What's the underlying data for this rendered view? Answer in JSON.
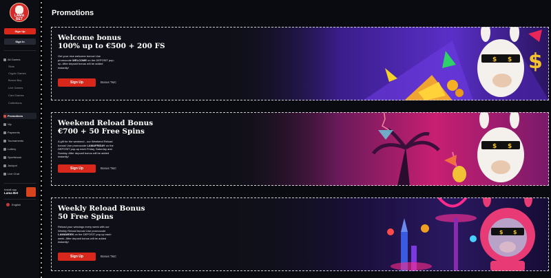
{
  "brand": {
    "logo_text": "LAMA BET"
  },
  "sidebar": {
    "signup_label": "Sign Up",
    "signin_label": "Sign In",
    "games_label": "All Games",
    "sub_items": [
      "Slots",
      "Crypto Games",
      "Bonus Buy",
      "Live Games",
      "Card Games",
      "Collections"
    ],
    "items": [
      "Promotions",
      "Vip",
      "Payments",
      "Tournaments",
      "Lottery",
      "Sportsbook",
      "Jackpot",
      "Live Chat"
    ],
    "install_line1": "Install app",
    "install_line2": "Lama Bet",
    "language": "English"
  },
  "page": {
    "title": "Promotions"
  },
  "promos": [
    {
      "title_line1": "Welcome bonus",
      "title_line2": "100% up to €500 + 200 FS",
      "desc_pre": "Get your nice welcome bonus! Use promocode ",
      "desc_code": "WELCOME",
      "desc_mid": " on the DEPOSIT pop-up. After deposit bonus will be added instantly!",
      "cta": "Sign Up",
      "terms": "Bonus T&C"
    },
    {
      "title_line1": "Weekend Reload Bonus",
      "title_line2": "€700 + 50 Free Spins",
      "desc_pre": "A gift for the weekend - our Weekend Reload bonus! Use promocode ",
      "desc_code": "LAMAFRIDAY",
      "desc_mid": " on the DEPOSIT pop-up each Friday, Saturday and Sunday. After deposit bonus will be added instantly!",
      "cta": "Sign Up",
      "terms": "Bonus T&C"
    },
    {
      "title_line1": "Weekly Reload Bonus",
      "title_line2": "50 Free Spins",
      "desc_pre": "Reload your winnings every week with our Weekly Reload bonus! Use promocode ",
      "desc_code": "LAMAWEEK",
      "desc_mid": " on the DEPOSIT pop-up each week. After deposit bonus will be added instantly!",
      "cta": "Sign Up",
      "terms": "Bonus T&C"
    }
  ],
  "colors": {
    "accent_red": "#d8281c",
    "bg": "#0a0b10",
    "sidebar_bg": "#0d0e14",
    "purple": "#6a2bd6",
    "magenta": "#d6247a"
  }
}
